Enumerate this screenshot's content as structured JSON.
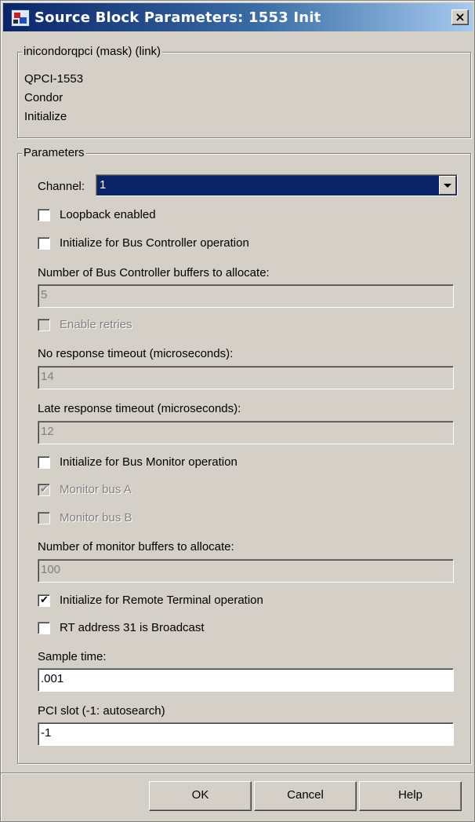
{
  "window": {
    "title": "Source Block Parameters: 1553 Init"
  },
  "description_group": {
    "legend": "inicondorqpci (mask) (link)",
    "lines": [
      "QPCI-1553",
      "Condor",
      "Initialize"
    ]
  },
  "parameters_group": {
    "legend": "Parameters",
    "channel_label": "Channel:",
    "channel_value": "1",
    "loopback": {
      "label": "Loopback enabled",
      "checked": false
    },
    "bus_controller": {
      "label": "Initialize for Bus Controller operation",
      "checked": false
    },
    "bc_buffers": {
      "label": "Number of Bus Controller buffers to allocate:",
      "value": "5"
    },
    "enable_retries": {
      "label": "Enable retries",
      "checked": false
    },
    "no_response": {
      "label": "No response timeout (microseconds):",
      "value": "14"
    },
    "late_response": {
      "label": "Late response timeout (microseconds):",
      "value": "12"
    },
    "bus_monitor": {
      "label": "Initialize for Bus Monitor operation",
      "checked": false
    },
    "monitor_a": {
      "label": "Monitor bus A",
      "checked": true
    },
    "monitor_b": {
      "label": "Monitor bus B",
      "checked": false
    },
    "monitor_buffers": {
      "label": "Number of monitor buffers to allocate:",
      "value": "100"
    },
    "remote_terminal": {
      "label": "Initialize for Remote Terminal operation",
      "checked": true
    },
    "rt_broadcast": {
      "label": "RT address 31 is Broadcast",
      "checked": false
    },
    "sample_time": {
      "label": "Sample time:",
      "value": ".001"
    },
    "pci_slot": {
      "label": "PCI slot (-1: autosearch)",
      "value": "-1"
    }
  },
  "buttons": {
    "ok": "OK",
    "cancel": "Cancel",
    "help": "Help"
  },
  "icons": {
    "checkmark_glyph": "✔",
    "close_glyph": "×"
  }
}
